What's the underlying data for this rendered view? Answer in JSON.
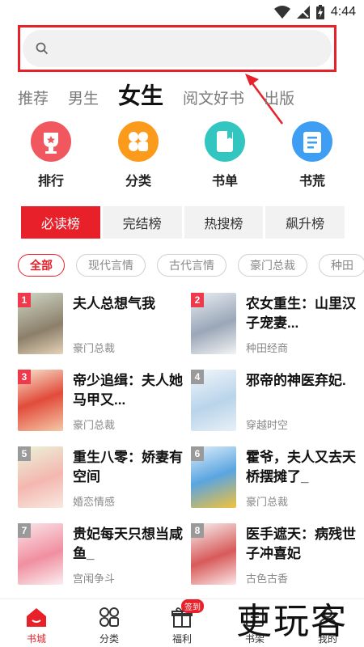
{
  "status": {
    "time": "4:44"
  },
  "search": {
    "placeholder": ""
  },
  "tabs": [
    "推荐",
    "男生",
    "女生",
    "阅文好书",
    "出版"
  ],
  "active_tab": 2,
  "categories": [
    {
      "label": "排行",
      "icon": "trophy-icon",
      "color": "#f0575f"
    },
    {
      "label": "分类",
      "icon": "grid-icon",
      "color": "#fb9a1b"
    },
    {
      "label": "书单",
      "icon": "book-icon",
      "color": "#33c6c0"
    },
    {
      "label": "书荒",
      "icon": "list-icon",
      "color": "#3e9ef4"
    }
  ],
  "rank_tabs": [
    "必读榜",
    "完结榜",
    "热搜榜",
    "飙升榜"
  ],
  "genres": [
    "全部",
    "现代言情",
    "古代言情",
    "豪门总裁",
    "种田"
  ],
  "books": [
    {
      "rank": "1",
      "title": "夫人总想气我",
      "category": "豪门总裁",
      "badge_color": "#f0394a"
    },
    {
      "rank": "2",
      "title": "农女重生：山里汉子宠妻...",
      "category": "种田经商",
      "badge_color": "#f0394a"
    },
    {
      "rank": "3",
      "title": "帝少追缉：夫人她马甲又...",
      "category": "豪门总裁",
      "badge_color": "#f0394a"
    },
    {
      "rank": "4",
      "title": "邪帝的神医弃妃.",
      "category": "穿越时空",
      "badge_color": "#9a9a9a"
    },
    {
      "rank": "5",
      "title": "重生八零：娇妻有空间",
      "category": "婚恋情感",
      "badge_color": "#9a9a9a"
    },
    {
      "rank": "6",
      "title": "霍爷，夫人又去天桥摆摊了_",
      "category": "豪门总裁",
      "badge_color": "#9a9a9a"
    },
    {
      "rank": "7",
      "title": "贵妃每天只想当咸鱼_",
      "category": "宫闱争斗",
      "badge_color": "#9a9a9a"
    },
    {
      "rank": "8",
      "title": "医手遮天：病残世子冲喜妃",
      "category": "古色古香",
      "badge_color": "#9a9a9a"
    }
  ],
  "nav": [
    {
      "label": "书城",
      "icon": "house-icon"
    },
    {
      "label": "分类",
      "icon": "grid-icon"
    },
    {
      "label": "福利",
      "icon": "gift-icon",
      "badge": "签到"
    },
    {
      "label": "书架",
      "icon": "bookshelf-icon"
    },
    {
      "label": "我的",
      "icon": "user-icon"
    }
  ],
  "active_nav": 0,
  "watermark": "吏玩客",
  "colors": {
    "accent": "#e8202a"
  }
}
